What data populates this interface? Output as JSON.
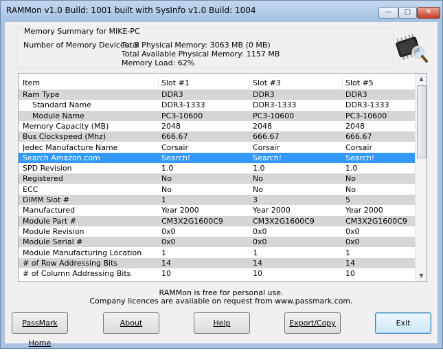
{
  "window": {
    "title": "RAMMon v1.0 Build: 1001 built with SysInfo v1.0 Build: 1004"
  },
  "summary": {
    "heading": "Memory Summary for MIKE-PC",
    "devices_label": "Number of Memory Devices: 3",
    "total_physical": "Total Physical Memory: 3063 MB (0 MB)",
    "total_available": "Total Available Physical Memory: 1157 MB",
    "memory_load": "Memory Load: 62%"
  },
  "table": {
    "columns": [
      "Item",
      "Slot #1",
      "Slot #3",
      "Slot #5"
    ],
    "rows": [
      {
        "item": "Ram Type",
        "s1": "DDR3",
        "s3": "DDR3",
        "s5": "DDR3",
        "style": "gray",
        "indent": 0
      },
      {
        "item": "Standard Name",
        "s1": "DDR3-1333",
        "s3": "DDR3-1333",
        "s5": "DDR3-1333",
        "style": "white",
        "indent": 1
      },
      {
        "item": "Module Name",
        "s1": "PC3-10600",
        "s3": "PC3-10600",
        "s5": "PC3-10600",
        "style": "gray",
        "indent": 1
      },
      {
        "item": "Memory Capacity (MB)",
        "s1": "2048",
        "s3": "2048",
        "s5": "2048",
        "style": "white",
        "indent": 0
      },
      {
        "item": "Bus Clockspeed (Mhz)",
        "s1": "666.67",
        "s3": "666.67",
        "s5": "666.67",
        "style": "gray",
        "indent": 0
      },
      {
        "item": "Jedec Manufacture Name",
        "s1": "Corsair",
        "s3": "Corsair",
        "s5": "Corsair",
        "style": "white",
        "indent": 0
      },
      {
        "item": "Search Amazon.com",
        "s1": "Search!",
        "s3": "Search!",
        "s5": "Search!",
        "style": "selected",
        "indent": 0
      },
      {
        "item": "SPD Revision",
        "s1": "1.0",
        "s3": "1.0",
        "s5": "1.0",
        "style": "white",
        "indent": 0
      },
      {
        "item": "Registered",
        "s1": "No",
        "s3": "No",
        "s5": "No",
        "style": "gray",
        "indent": 0
      },
      {
        "item": "ECC",
        "s1": "No",
        "s3": "No",
        "s5": "No",
        "style": "white",
        "indent": 0
      },
      {
        "item": "DIMM Slot #",
        "s1": "1",
        "s3": "3",
        "s5": "5",
        "style": "gray",
        "indent": 0
      },
      {
        "item": "Manufactured",
        "s1": "Year 2000",
        "s3": "Year 2000",
        "s5": "Year 2000",
        "style": "white",
        "indent": 0
      },
      {
        "item": "Module Part #",
        "s1": "CM3X2G1600C9",
        "s3": "CM3X2G1600C9",
        "s5": "CM3X2G1600C9",
        "style": "gray",
        "indent": 0
      },
      {
        "item": "Module Revision",
        "s1": "0x0",
        "s3": "0x0",
        "s5": "0x0",
        "style": "white",
        "indent": 0
      },
      {
        "item": "Module Serial #",
        "s1": "0x0",
        "s3": "0x0",
        "s5": "0x0",
        "style": "gray",
        "indent": 0
      },
      {
        "item": "Module Manufacturing Location",
        "s1": "1",
        "s3": "1",
        "s5": "1",
        "style": "white",
        "indent": 0
      },
      {
        "item": "# of Row Addressing Bits",
        "s1": "14",
        "s3": "14",
        "s5": "14",
        "style": "gray",
        "indent": 0
      },
      {
        "item": "# of Column Addressing Bits",
        "s1": "10",
        "s3": "10",
        "s5": "10",
        "style": "white",
        "indent": 0
      }
    ]
  },
  "notice": {
    "line1": "RAMMon is free for personal use.",
    "line2": "Company licences are available on request from www.passmark.com."
  },
  "buttons": {
    "passmark_home": "PassMark Home",
    "about": "About",
    "help": "Help",
    "export_copy": "Export/Copy",
    "exit": "Exit"
  },
  "icons": {
    "app_icon": "memory-chip-magnifier-icon",
    "scroll_up": "scroll-up-arrow-icon",
    "scroll_down": "scroll-down-arrow-icon"
  },
  "colors": {
    "selection": "#3399ff",
    "row_alt": "#d6d6d6",
    "title_bar": "#a9c4e2",
    "close_button": "#c53e25"
  }
}
